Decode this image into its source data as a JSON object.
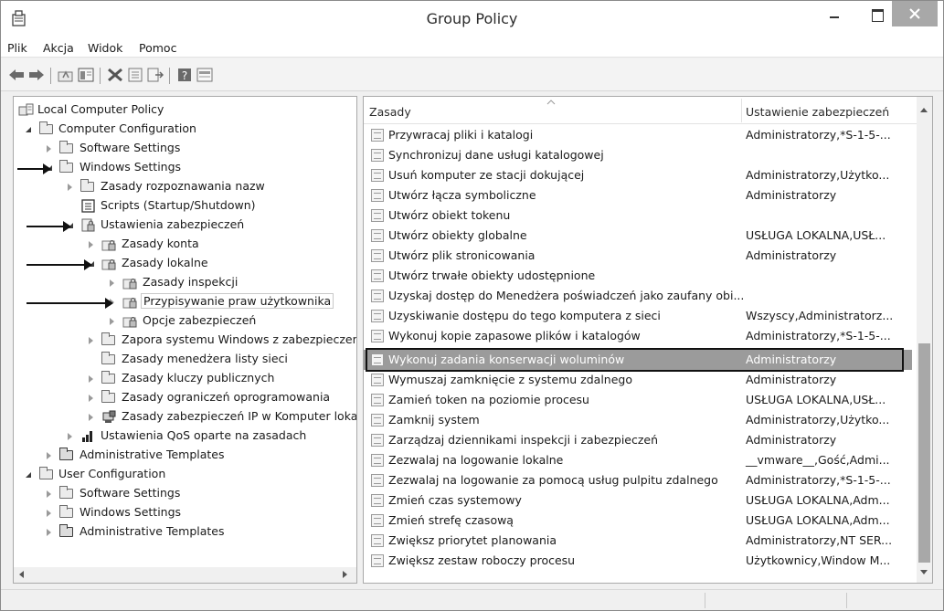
{
  "window": {
    "title": "Group Policy"
  },
  "menu": [
    "Plik",
    "Akcja",
    "Widok",
    "Pomoc"
  ],
  "toolbar_icons": [
    "back-arrow-icon",
    "forward-arrow-icon",
    "up-folder-icon",
    "show-hide-tree-icon",
    "delete-icon",
    "properties-icon",
    "export-list-icon",
    "help-icon",
    "console-view-icon"
  ],
  "tree": [
    {
      "label": "Local Computer Policy",
      "icon": "computer-policy-icon",
      "toggle": "none"
    },
    {
      "label": "Computer Configuration",
      "icon": "folder-icon",
      "toggle": "expanded"
    },
    {
      "label": "Software Settings",
      "icon": "folder-icon",
      "toggle": "collapsed"
    },
    {
      "label": "Windows Settings",
      "icon": "folder-icon",
      "toggle": "expanded"
    },
    {
      "label": "Zasady rozpoznawania nazw",
      "icon": "folder-icon",
      "toggle": "collapsed"
    },
    {
      "label": "Scripts (Startup/Shutdown)",
      "icon": "scripts-icon",
      "toggle": "none"
    },
    {
      "label": "Ustawienia zabezpieczeń",
      "icon": "security-settings-icon",
      "toggle": "expanded"
    },
    {
      "label": "Zasady konta",
      "icon": "security-folder-icon",
      "toggle": "collapsed"
    },
    {
      "label": "Zasady lokalne",
      "icon": "security-folder-icon",
      "toggle": "expanded"
    },
    {
      "label": "Zasady inspekcji",
      "icon": "security-folder-icon",
      "toggle": "collapsed"
    },
    {
      "label": "Przypisywanie praw użytkownika",
      "icon": "security-folder-icon",
      "toggle": "collapsed",
      "selected": true
    },
    {
      "label": "Opcje zabezpieczeń",
      "icon": "security-folder-icon",
      "toggle": "collapsed"
    },
    {
      "label": "Zapora systemu Windows z zabezpieczeni",
      "icon": "folder-icon",
      "toggle": "collapsed"
    },
    {
      "label": "Zasady menedżera listy sieci",
      "icon": "folder-icon",
      "toggle": "none"
    },
    {
      "label": "Zasady kluczy publicznych",
      "icon": "folder-icon",
      "toggle": "collapsed"
    },
    {
      "label": "Zasady ograniczeń oprogramowania",
      "icon": "folder-icon",
      "toggle": "collapsed"
    },
    {
      "label": "Zasady zabezpieczeń IP w Komputer lokal",
      "icon": "ip-security-icon",
      "toggle": "collapsed"
    },
    {
      "label": "Ustawienia QoS oparte na zasadach",
      "icon": "qos-chart-icon",
      "toggle": "collapsed"
    },
    {
      "label": "Administrative Templates",
      "icon": "folder-dark-icon",
      "toggle": "collapsed"
    },
    {
      "label": "User Configuration",
      "icon": "folder-icon",
      "toggle": "expanded"
    },
    {
      "label": "Software Settings",
      "icon": "folder-icon",
      "toggle": "collapsed"
    },
    {
      "label": "Windows Settings",
      "icon": "folder-icon",
      "toggle": "collapsed"
    },
    {
      "label": "Administrative Templates",
      "icon": "folder-dark-icon",
      "toggle": "collapsed"
    }
  ],
  "list": {
    "columns": [
      "Zasady",
      "Ustawienie zabezpieczeń"
    ],
    "rows": [
      {
        "name": "Przywracaj pliki i katalogi",
        "setting": "Administratorzy,*S-1-5-..."
      },
      {
        "name": "Synchronizuj dane usługi katalogowej",
        "setting": ""
      },
      {
        "name": "Usuń komputer ze stacji dokującej",
        "setting": "Administratorzy,Użytko..."
      },
      {
        "name": "Utwórz łącza symboliczne",
        "setting": "Administratorzy"
      },
      {
        "name": "Utwórz obiekt tokenu",
        "setting": ""
      },
      {
        "name": "Utwórz obiekty globalne",
        "setting": "USŁUGA LOKALNA,USŁ..."
      },
      {
        "name": "Utwórz plik stronicowania",
        "setting": "Administratorzy"
      },
      {
        "name": "Utwórz trwałe obiekty udostępnione",
        "setting": ""
      },
      {
        "name": "Uzyskaj dostęp do Menedżera poświadczeń jako zaufany obi...",
        "setting": ""
      },
      {
        "name": "Uzyskiwanie dostępu do tego komputera z sieci",
        "setting": "Wszyscy,Administratorz..."
      },
      {
        "name": "Wykonuj kopie zapasowe plików i katalogów",
        "setting": "Administratorzy,*S-1-5-..."
      },
      {
        "name": "Wykonuj zadania konserwacji woluminów",
        "setting": "Administratorzy",
        "selected": true
      },
      {
        "name": "Wymuszaj zamknięcie z systemu zdalnego",
        "setting": "Administratorzy"
      },
      {
        "name": "Zamień token na poziomie procesu",
        "setting": "USŁUGA LOKALNA,USŁ..."
      },
      {
        "name": "Zamknij system",
        "setting": "Administratorzy,Użytko..."
      },
      {
        "name": "Zarządzaj dziennikami inspekcji i zabezpieczeń",
        "setting": "Administratorzy"
      },
      {
        "name": "Zezwalaj na logowanie lokalne",
        "setting": "__vmware__,Gość,Admi..."
      },
      {
        "name": "Zezwalaj na logowanie za pomocą usług pulpitu zdalnego",
        "setting": "Administratorzy,*S-1-5-..."
      },
      {
        "name": "Zmień czas systemowy",
        "setting": "USŁUGA LOKALNA,Adm..."
      },
      {
        "name": "Zmień strefę czasową",
        "setting": "USŁUGA LOKALNA,Adm..."
      },
      {
        "name": "Zwiększ priorytet planowania",
        "setting": "Administratorzy,NT SER..."
      },
      {
        "name": "Zwiększ zestaw roboczy procesu",
        "setting": "Użytkownicy,Window M..."
      }
    ]
  },
  "colors": {
    "selection": "#9b9b9b",
    "close_button": "#a8a8a8",
    "annotation": "#111111"
  }
}
